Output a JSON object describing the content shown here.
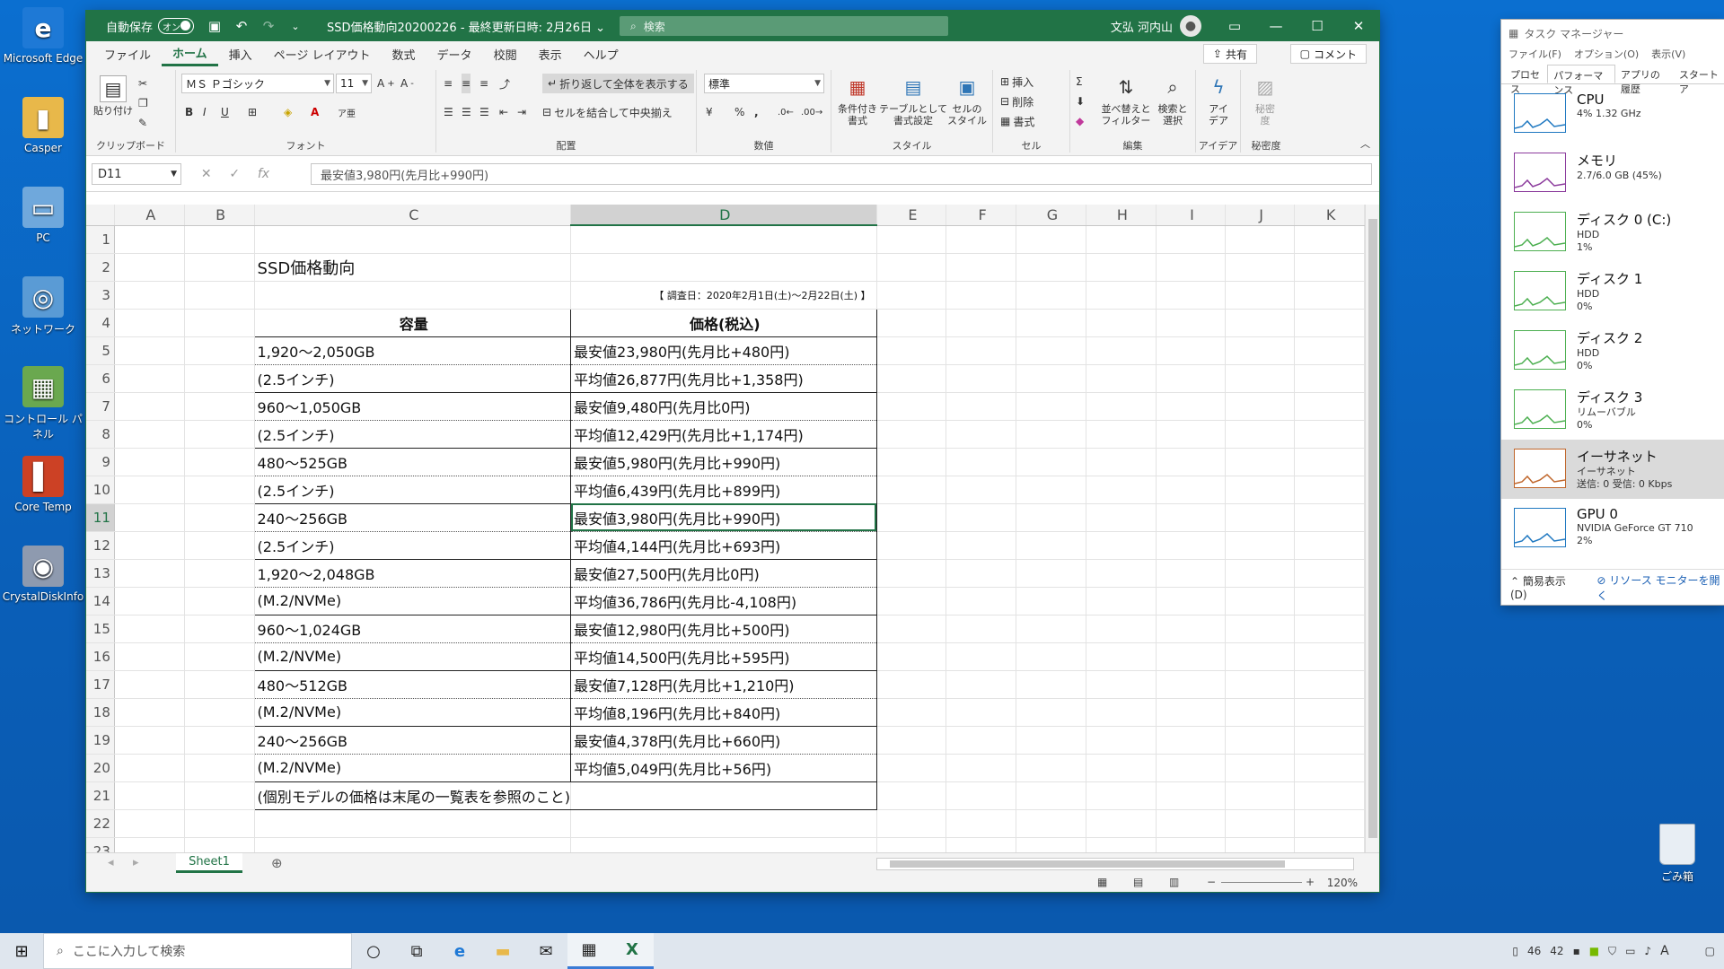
{
  "desktop": {
    "icons": [
      {
        "label": "Microsoft Edge",
        "icon": "edge-icon",
        "color": "#1e79d6",
        "glyph": "e"
      },
      {
        "label": "Casper",
        "icon": "user-folder-icon",
        "color": "#e8b84a",
        "glyph": "▮"
      },
      {
        "label": "PC",
        "icon": "computer-icon",
        "color": "#6fa8dc",
        "glyph": "▭"
      },
      {
        "label": "ネットワーク",
        "icon": "network-icon",
        "color": "#5a9bd5",
        "glyph": "◎"
      },
      {
        "label": "コントロール パネル",
        "icon": "control-panel-icon",
        "color": "#6aa84f",
        "glyph": "▦"
      },
      {
        "label": "Core Temp",
        "icon": "thermometer-icon",
        "color": "#cc4125",
        "glyph": "▌"
      },
      {
        "label": "CrystalDiskInfo",
        "icon": "disk-icon",
        "color": "#8e9aaf",
        "glyph": "◉"
      }
    ],
    "recycle": "ごみ箱"
  },
  "excel": {
    "autosave_label": "自動保存",
    "autosave_state": "オン",
    "title": "SSD価格動向20200226 - 最終更新日時: 2月26日 ⌄",
    "search_placeholder": "検索",
    "user": "文弘 河内山",
    "menu": [
      "ファイル",
      "ホーム",
      "挿入",
      "ページ レイアウト",
      "数式",
      "データ",
      "校閲",
      "表示",
      "ヘルプ"
    ],
    "share": "共有",
    "comment": "コメント",
    "ribbon": {
      "paste": "貼り付け",
      "clipboard": "クリップボード",
      "font_name": "ＭＳ Ｐゴシック",
      "font_size": "11",
      "font_group": "フォント",
      "wrap": "折り返して全体を表示する",
      "merge": "セルを結合して中央揃え",
      "align_group": "配置",
      "number_format": "標準",
      "number_group": "数値",
      "cond_fmt": "条件付き\n書式",
      "table_fmt": "テーブルとして\n書式設定",
      "cell_style": "セルの\nスタイル",
      "style_group": "スタイル",
      "insert": "挿入",
      "delete": "削除",
      "format": "書式",
      "cells_group": "セル",
      "sort": "並べ替えと\nフィルター",
      "find": "検索と\n選択",
      "edit_group": "編集",
      "ideas": "アイ\nデア",
      "ideas_group": "アイデア",
      "sens": "秘密\n度",
      "sens_group": "秘密度"
    },
    "namebox": "D11",
    "formula": "最安値3,980円(先月比+990円)",
    "columns": [
      "A",
      "B",
      "C",
      "D",
      "E",
      "F",
      "G",
      "H",
      "I",
      "J",
      "K"
    ],
    "sheet": {
      "title": "SSD価格動向",
      "date_note": "【 調査日：2020年2月1日(土)～2月22日(土) 】",
      "header_capacity": "容量",
      "header_price": "価格(税込)",
      "rows": [
        [
          "1,920～2,050GB",
          "最安値23,980円(先月比+480円)"
        ],
        [
          "(2.5インチ)",
          "平均値26,877円(先月比+1,358円)"
        ],
        [
          "960～1,050GB",
          "最安値9,480円(先月比0円)"
        ],
        [
          "(2.5インチ)",
          "平均値12,429円(先月比+1,174円)"
        ],
        [
          "480～525GB",
          "最安値5,980円(先月比+990円)"
        ],
        [
          "(2.5インチ)",
          "平均値6,439円(先月比+899円)"
        ],
        [
          "240～256GB",
          "最安値3,980円(先月比+990円)"
        ],
        [
          "(2.5インチ)",
          "平均値4,144円(先月比+693円)"
        ],
        [
          "1,920～2,048GB",
          "最安値27,500円(先月比0円)"
        ],
        [
          "(M.2/NVMe)",
          "平均値36,786円(先月比-4,108円)"
        ],
        [
          "960～1,024GB",
          "最安値12,980円(先月比+500円)"
        ],
        [
          "(M.2/NVMe)",
          "平均値14,500円(先月比+595円)"
        ],
        [
          "480～512GB",
          "最安値7,128円(先月比+1,210円)"
        ],
        [
          "(M.2/NVMe)",
          "平均値8,196円(先月比+840円)"
        ],
        [
          "240～256GB",
          "最安値4,378円(先月比+660円)"
        ],
        [
          "(M.2/NVMe)",
          "平均値5,049円(先月比+56円)"
        ]
      ],
      "footnote": "(個別モデルの価格は末尾の一覧表を参照のこと)"
    },
    "sheet_tab": "Sheet1",
    "zoom": "120%"
  },
  "taskmgr": {
    "title": "タスク マネージャー",
    "menu": [
      "ファイル(F)",
      "オプション(O)",
      "表示(V)"
    ],
    "tabs": [
      "プロセス",
      "パフォーマンス",
      "アプリの履歴",
      "スタートア"
    ],
    "items": [
      {
        "name": "CPU",
        "sub1": "4%  1.32 GHz",
        "sub2": "",
        "color": "#1f78c1"
      },
      {
        "name": "メモリ",
        "sub1": "2.7/6.0 GB (45%)",
        "sub2": "",
        "color": "#8b3a9c"
      },
      {
        "name": "ディスク 0 (C:)",
        "sub1": "HDD",
        "sub2": "1%",
        "color": "#4caf50"
      },
      {
        "name": "ディスク 1",
        "sub1": "HDD",
        "sub2": "0%",
        "color": "#4caf50"
      },
      {
        "name": "ディスク 2",
        "sub1": "HDD",
        "sub2": "0%",
        "color": "#4caf50"
      },
      {
        "name": "ディスク 3",
        "sub1": "リムーバブル",
        "sub2": "0%",
        "color": "#4caf50"
      },
      {
        "name": "イーサネット",
        "sub1": "イーサネット",
        "sub2": "送信: 0 受信: 0 Kbps",
        "color": "#c0662b"
      },
      {
        "name": "GPU 0",
        "sub1": "NVIDIA GeForce GT 710",
        "sub2": "2%",
        "color": "#1f78c1"
      }
    ],
    "simple": "簡易表示(D)",
    "resmon": "リソース モニターを開く"
  },
  "taskbar": {
    "search_placeholder": "ここに入力して検索",
    "tray_a": "46",
    "tray_b": "42",
    "ime": "A"
  }
}
